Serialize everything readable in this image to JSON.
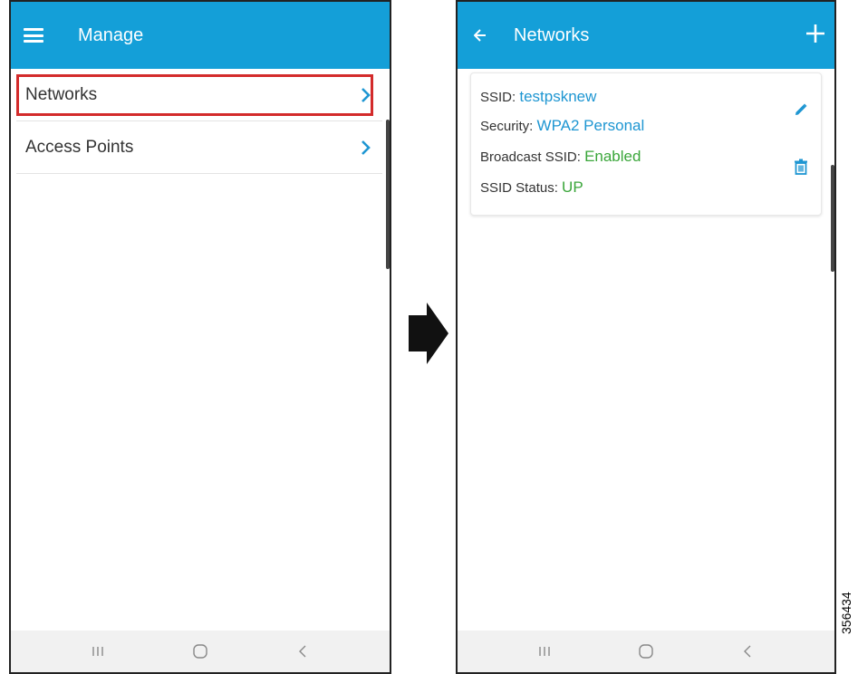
{
  "left_screen": {
    "header": {
      "title": "Manage",
      "menu_icon": "menu-icon"
    },
    "items": [
      {
        "label": "Networks",
        "icon": "chevron-right-icon",
        "highlighted": true
      },
      {
        "label": "Access Points",
        "icon": "chevron-right-icon",
        "highlighted": false
      }
    ]
  },
  "right_screen": {
    "header": {
      "title": "Networks",
      "back_icon": "arrow-left-icon",
      "add_icon": "plus-icon"
    },
    "network_card": {
      "ssid_label": "SSID:",
      "ssid_value": "testpsknew",
      "security_label": "Security:",
      "security_value": "WPA2 Personal",
      "broadcast_label": "Broadcast SSID:",
      "broadcast_value": "Enabled",
      "status_label": "SSID Status:",
      "status_value": "UP",
      "actions": [
        "pencil-icon",
        "trash-icon"
      ]
    }
  },
  "nav_bar": {
    "buttons": [
      "recent-apps-icon",
      "home-icon",
      "back-icon"
    ]
  },
  "figure_id": "356434",
  "colors": {
    "header_bg": "#149fd8",
    "link_blue": "#1e96d2",
    "status_green": "#3aa63a",
    "highlight_red": "#d32b2b",
    "nav_bg": "#f1f1f1"
  }
}
